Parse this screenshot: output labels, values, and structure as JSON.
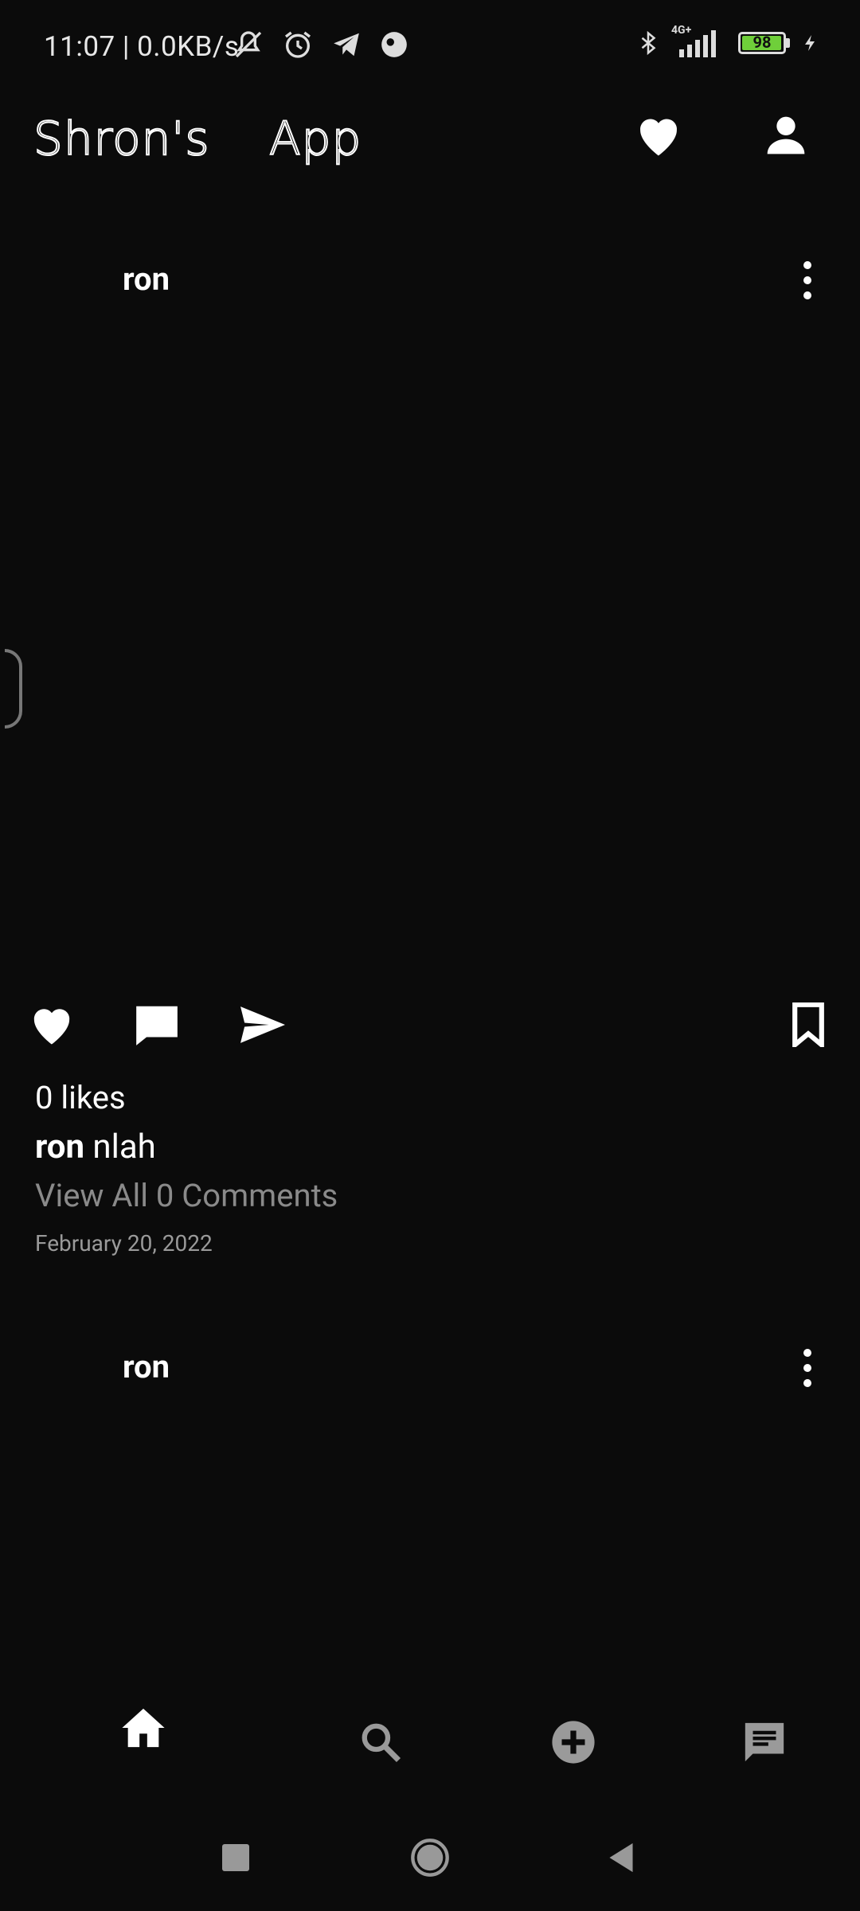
{
  "status_bar": {
    "time": "11:07 | 0.0KB/s",
    "network": "4G+",
    "battery": "98",
    "battery_level": 0.98
  },
  "header": {
    "title_part1": "Shron's",
    "title_part2": "App",
    "icons": [
      "heart-icon",
      "profile-icon"
    ]
  },
  "posts": [
    {
      "username": "ron",
      "likes": "0 likes",
      "caption_user": "ron",
      "caption_text": "nlah",
      "view_comments": "View All 0 Comments",
      "date": "February 20, 2022"
    },
    {
      "username": "ron"
    }
  ],
  "bottom_nav": [
    "home-icon",
    "search-icon",
    "add-post-icon",
    "chat-icon"
  ],
  "colors": {
    "background": "#0b0b0b",
    "battery": "#6fcf3a",
    "muted_text": "#8a8a8a",
    "inactive_nav": "#9a9a9a"
  }
}
